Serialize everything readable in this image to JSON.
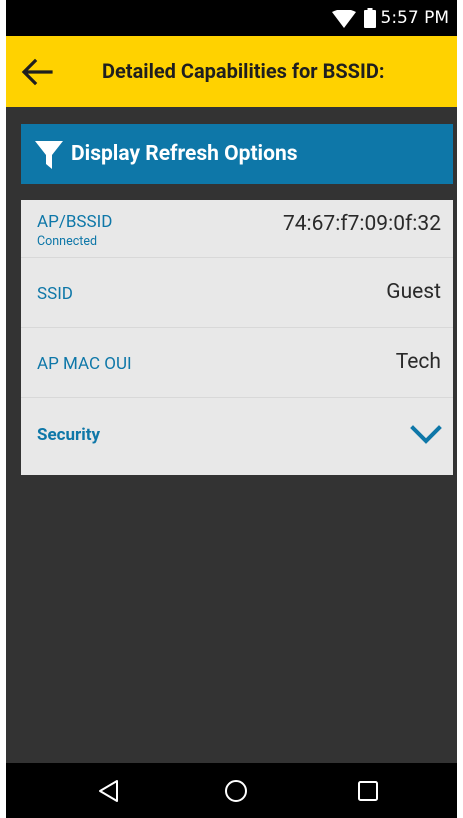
{
  "status_bar": {
    "time": "5:57 PM",
    "icons": [
      "wifi-icon",
      "battery-icon"
    ]
  },
  "toolbar": {
    "title": "Detailed Capabilities for BSSID:",
    "back_icon": "arrow-left-icon",
    "background_color": "#ffd200"
  },
  "refresh_options": {
    "label": "Display Refresh Options",
    "icon": "filter-icon",
    "background_color": "#0e77a8"
  },
  "details": {
    "bssid": {
      "label": "AP/BSSID",
      "status": "Connected",
      "value": "74:67:f7:09:0f:32"
    },
    "ssid": {
      "label": "SSID",
      "value": "Guest"
    },
    "ap_mac_oui": {
      "label": "AP MAC OUI",
      "value": "Tech"
    },
    "security": {
      "label": "Security",
      "icon": "chevron-down-icon"
    },
    "accent_color": "#0e77a8"
  },
  "nav_bar": {
    "icons": [
      "nav-back-icon",
      "nav-home-icon",
      "nav-recents-icon"
    ]
  }
}
